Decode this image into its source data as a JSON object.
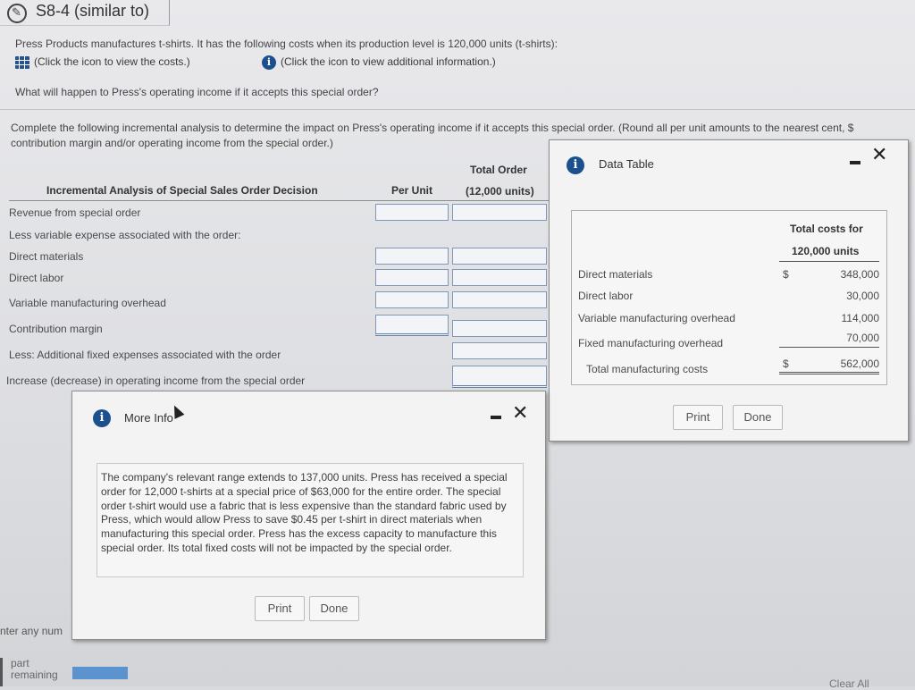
{
  "header": {
    "title": "S8-4 (similar to)"
  },
  "question": {
    "intro": "Press Products manufactures t-shirts. It has the following costs when its production level is 120,000 units (t-shirts):",
    "costs_link": "(Click the icon to view the costs.)",
    "more_info_link": "(Click the icon to view additional information.)",
    "prompt": "What will happen to Press's operating income if it accepts this special order?",
    "instruction_line1": "Complete the following incremental analysis to determine the impact on Press's operating income if it accepts this special order. (Round all per unit amounts to the nearest cent, $",
    "instruction_line2": "contribution margin and/or operating income from the special order.)"
  },
  "analysis_table": {
    "title": "Incremental Analysis of Special Sales Order Decision",
    "col_per_unit": "Per Unit",
    "col_total_line1": "Total Order",
    "col_total_line2": "(12,000 units)",
    "rows": {
      "revenue": "Revenue from special order",
      "less_variable": "Less variable expense associated with the order:",
      "direct_materials": "Direct materials",
      "direct_labor": "Direct labor",
      "variable_overhead": "Variable manufacturing overhead",
      "contribution_margin": "Contribution margin",
      "less_fixed": "Less: Additional fixed expenses associated with the order",
      "increase": "Increase (decrease) in operating income from the special order"
    }
  },
  "data_table": {
    "title": "Data Table",
    "header_line1": "Total costs for",
    "header_line2": "120,000 units",
    "rows": [
      {
        "label": "Direct materials",
        "currency": "$",
        "value": "348,000"
      },
      {
        "label": "Direct labor",
        "currency": "",
        "value": "30,000"
      },
      {
        "label": "Variable manufacturing overhead",
        "currency": "",
        "value": "114,000"
      },
      {
        "label": "Fixed manufacturing overhead",
        "currency": "",
        "value": "70,000"
      }
    ],
    "total": {
      "label": "Total manufacturing costs",
      "currency": "$",
      "value": "562,000"
    },
    "print_label": "Print",
    "done_label": "Done"
  },
  "more_info": {
    "title": "More Info",
    "body": "The company's relevant range extends to 137,000 units. Press has received a special order for 12,000 t-shirts at a special price of $63,000 for the entire order. The special order t-shirt would use a fabric that is less expensive than the standard fabric used by Press, which would allow Press to save $0.45 per t-shirt in direct materials when manufacturing this special order. Press has the excess capacity to manufacture this special order. Its total fixed costs will not be impacted by the special order.",
    "print_label": "Print",
    "done_label": "Done"
  },
  "footer": {
    "enter_text": "nter any num",
    "part_line1": "part",
    "part_line2": "remaining",
    "clear_label": "Clear All"
  }
}
